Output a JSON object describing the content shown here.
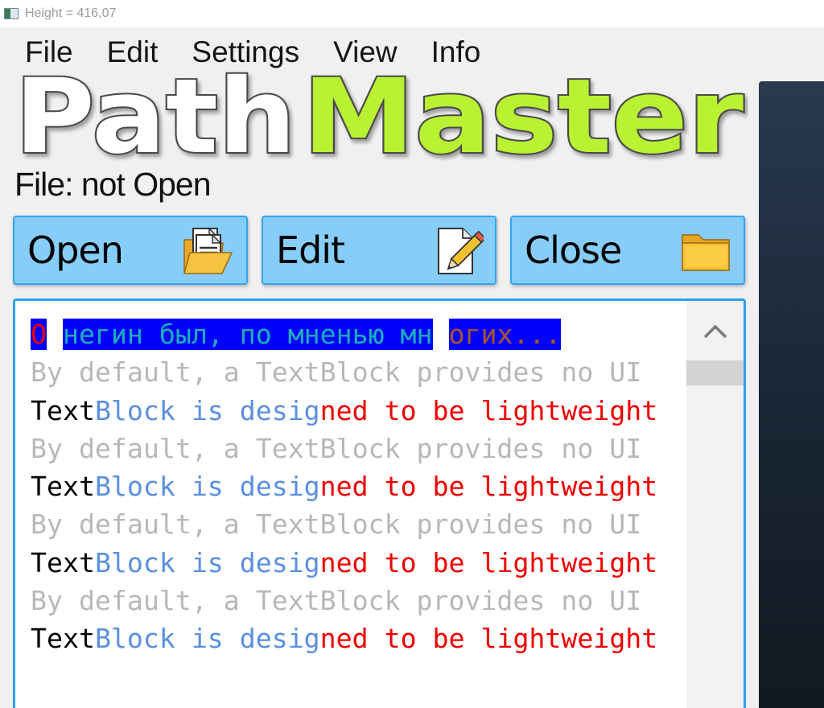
{
  "window": {
    "title": "Height = 416,07"
  },
  "menu": {
    "items": [
      "File",
      "Edit",
      "Settings",
      "View",
      "Info"
    ]
  },
  "logo": {
    "part1": "Path",
    "part2": "Master",
    "color_part1": "#ffffff",
    "color_part2": "#b9f230"
  },
  "file_status": "File: not Open",
  "buttons": {
    "open": "Open",
    "edit": "Edit",
    "close": "Close"
  },
  "colors": {
    "button_fill": "#87cdf9",
    "button_border": "#31a6ef",
    "highlight": "#0000ff",
    "red": "#ee0000",
    "teal": "#19b0b8",
    "brown": "#a8552a",
    "gray": "#b8b8b8",
    "blue": "#5b8fe0"
  },
  "text_block": {
    "first_line": {
      "seg1": "О",
      "seg2": "негин был, по мненью мн",
      "seg3": "огих..."
    },
    "gray_line": "By default, a TextBlock provides no UI",
    "colored_line": {
      "seg1": "Text",
      "seg2": "Block is desig",
      "seg3": "ned to be lightweight"
    }
  }
}
